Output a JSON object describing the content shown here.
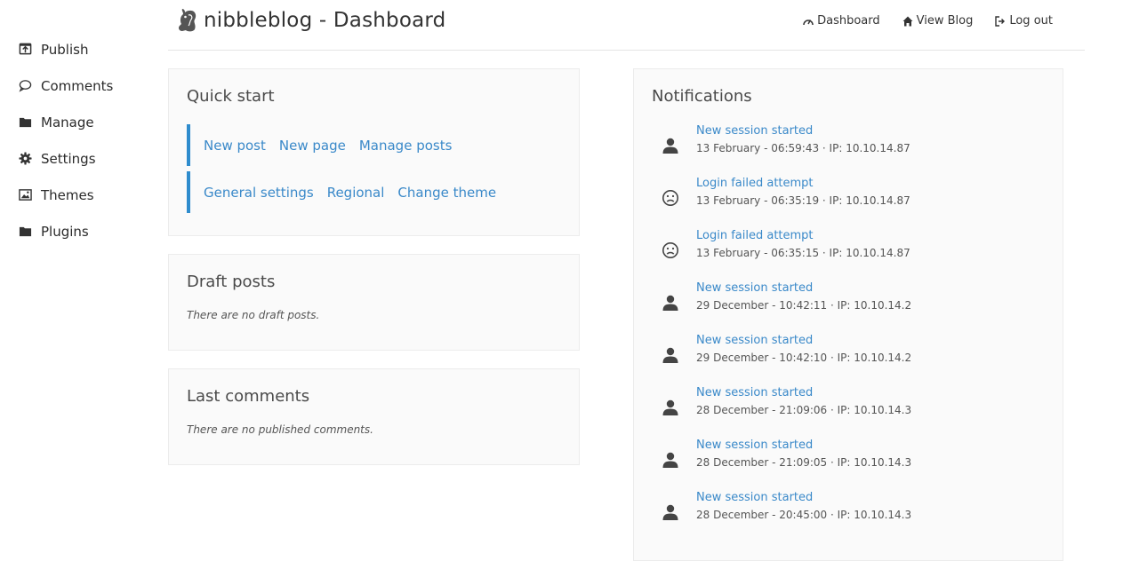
{
  "sidebar": {
    "items": [
      {
        "label": "Publish",
        "icon": "publish-icon"
      },
      {
        "label": "Comments",
        "icon": "comment-icon"
      },
      {
        "label": "Manage",
        "icon": "folder-icon"
      },
      {
        "label": "Settings",
        "icon": "gear-icon"
      },
      {
        "label": "Themes",
        "icon": "image-icon"
      },
      {
        "label": "Plugins",
        "icon": "folder-icon"
      }
    ]
  },
  "header": {
    "title": "nibbleblog - Dashboard",
    "nav": [
      {
        "label": "Dashboard",
        "icon": "dashboard-icon"
      },
      {
        "label": "View Blog",
        "icon": "home-icon"
      },
      {
        "label": "Log out",
        "icon": "logout-icon"
      }
    ]
  },
  "quick_start": {
    "title": "Quick start",
    "row1": [
      "New post",
      "New page",
      "Manage posts"
    ],
    "row2": [
      "General settings",
      "Regional",
      "Change theme"
    ]
  },
  "draft_posts": {
    "title": "Draft posts",
    "empty": "There are no draft posts."
  },
  "last_comments": {
    "title": "Last comments",
    "empty": "There are no published comments."
  },
  "notifications": {
    "title": "Notifications",
    "items": [
      {
        "title": "New session started",
        "detail": "13 February - 06:59:43 · IP: 10.10.14.87",
        "icon": "user-icon"
      },
      {
        "title": "Login failed attempt",
        "detail": "13 February - 06:35:19 · IP: 10.10.14.87",
        "icon": "sad-face-icon"
      },
      {
        "title": "Login failed attempt",
        "detail": "13 February - 06:35:15 · IP: 10.10.14.87",
        "icon": "sad-face-icon"
      },
      {
        "title": "New session started",
        "detail": "29 December - 10:42:11 · IP: 10.10.14.2",
        "icon": "user-icon"
      },
      {
        "title": "New session started",
        "detail": "29 December - 10:42:10 · IP: 10.10.14.2",
        "icon": "user-icon"
      },
      {
        "title": "New session started",
        "detail": "28 December - 21:09:06 · IP: 10.10.14.3",
        "icon": "user-icon"
      },
      {
        "title": "New session started",
        "detail": "28 December - 21:09:05 · IP: 10.10.14.3",
        "icon": "user-icon"
      },
      {
        "title": "New session started",
        "detail": "28 December - 20:45:00 · IP: 10.10.14.3",
        "icon": "user-icon"
      }
    ]
  },
  "colors": {
    "accent": "#2e8ccd",
    "link": "#3a89c9",
    "panel_bg": "#fafafa"
  }
}
